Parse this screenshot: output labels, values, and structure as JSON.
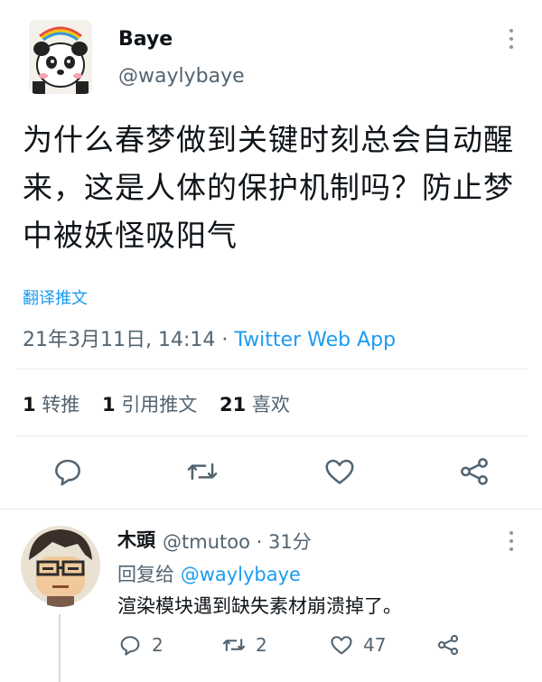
{
  "tweet": {
    "author_name": "Baye",
    "author_handle": "@waylybaye",
    "text": "为什么春梦做到关键时刻总会自动醒来，这是人体的保护机制吗？防止梦中被妖怪吸阳气",
    "translate_label": "翻译推文",
    "timestamp": "21年3月11日, 14:14",
    "separator": "·",
    "app": "Twitter Web App",
    "stats": {
      "retweets_count": "1",
      "retweets_label": "转推",
      "quotes_count": "1",
      "quotes_label": "引用推文",
      "likes_count": "21",
      "likes_label": "喜欢"
    },
    "actions": [
      "reply-icon",
      "retweet-icon",
      "like-icon",
      "share-icon"
    ]
  },
  "reply": {
    "author_name": "木頭",
    "author_handle": "@tmutoo · 31分",
    "reply_to_label": "回复给",
    "reply_to_handle": "@waylybaye",
    "text": "渲染模块遇到缺失素材崩溃掉了。",
    "reply_count": "2",
    "retweet_count": "2",
    "like_count": "47"
  },
  "colors": {
    "accent": "#1d9bf0",
    "secondary_text": "#536471",
    "primary_text": "#0f1419",
    "divider": "#e6ecf0"
  }
}
